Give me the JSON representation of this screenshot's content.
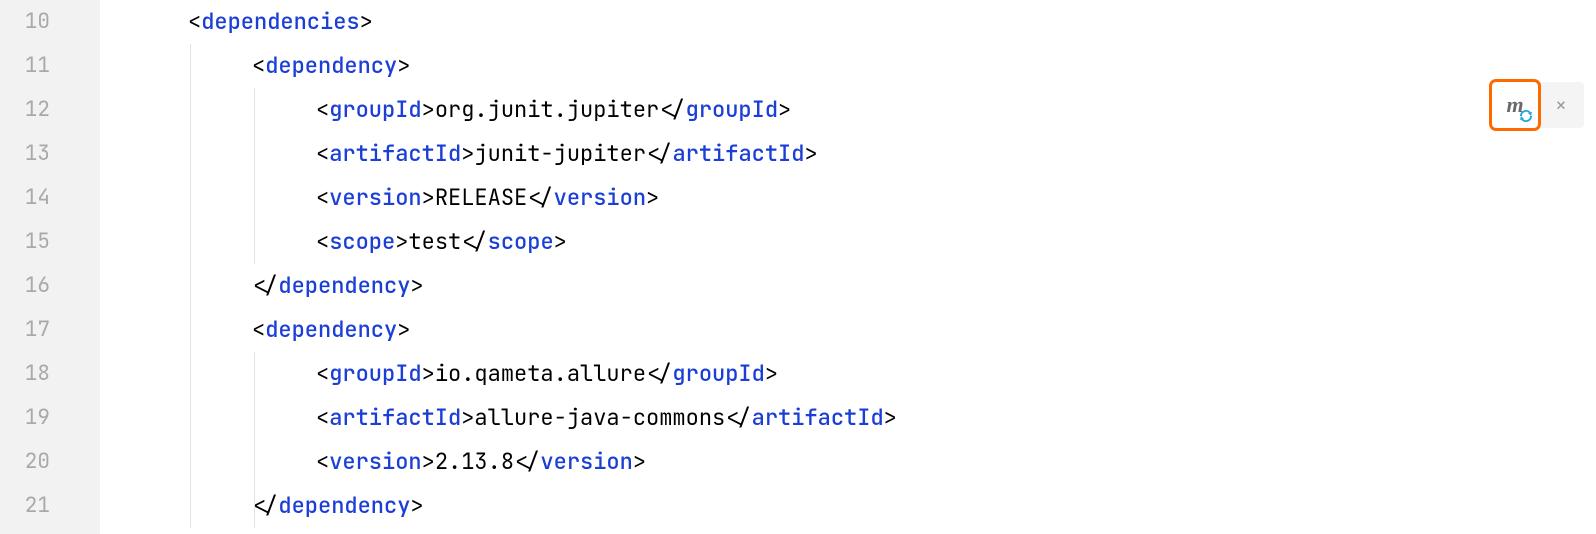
{
  "gutter": {
    "lines": [
      "10",
      "11",
      "12",
      "13",
      "14",
      "15",
      "16",
      "17",
      "18",
      "19",
      "20",
      "21"
    ]
  },
  "code": {
    "lines": [
      {
        "indent": 1,
        "open": true,
        "tag": "dependencies",
        "text": ""
      },
      {
        "indent": 2,
        "open": true,
        "tag": "dependency",
        "text": ""
      },
      {
        "indent": 3,
        "open": null,
        "tag": "groupId",
        "text": "org.junit.jupiter"
      },
      {
        "indent": 3,
        "open": null,
        "tag": "artifactId",
        "text": "junit-jupiter"
      },
      {
        "indent": 3,
        "open": null,
        "tag": "version",
        "text": "RELEASE"
      },
      {
        "indent": 3,
        "open": null,
        "tag": "scope",
        "text": "test"
      },
      {
        "indent": 2,
        "open": false,
        "tag": "dependency",
        "text": ""
      },
      {
        "indent": 2,
        "open": true,
        "tag": "dependency",
        "text": ""
      },
      {
        "indent": 3,
        "open": null,
        "tag": "groupId",
        "text": "io.qameta.allure"
      },
      {
        "indent": 3,
        "open": null,
        "tag": "artifactId",
        "text": "allure-java-commons"
      },
      {
        "indent": 3,
        "open": null,
        "tag": "version",
        "text": "2.13.8"
      },
      {
        "indent": 2,
        "open": false,
        "tag": "dependency",
        "text": ""
      }
    ]
  },
  "fold_markers": [
    {
      "line_index": 0,
      "kind": "start"
    },
    {
      "line_index": 1,
      "kind": "start"
    },
    {
      "line_index": 6,
      "kind": "end"
    },
    {
      "line_index": 7,
      "kind": "start"
    },
    {
      "line_index": 11,
      "kind": "end"
    }
  ],
  "widget": {
    "maven_icon_label": "m",
    "close_label": "×"
  }
}
